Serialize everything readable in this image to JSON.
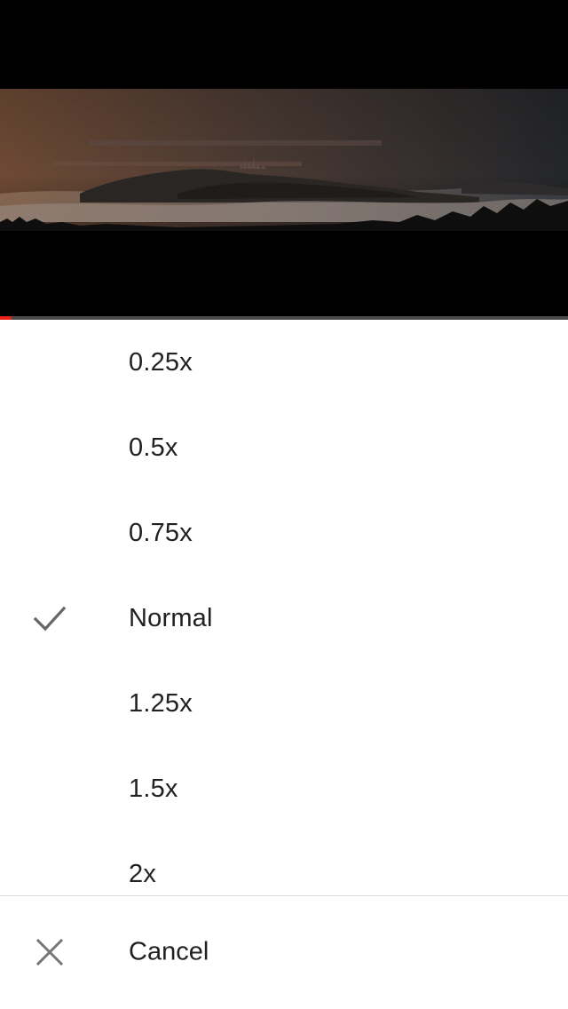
{
  "player": {
    "thumbnail": "sunrise-fog-hills-landscape",
    "progress_fraction": 0.02,
    "progress_color": "#e62117"
  },
  "speed_menu": {
    "options": [
      {
        "label": "0.25x",
        "selected": false
      },
      {
        "label": "0.5x",
        "selected": false
      },
      {
        "label": "0.75x",
        "selected": false
      },
      {
        "label": "Normal",
        "selected": true
      },
      {
        "label": "1.25x",
        "selected": false
      },
      {
        "label": "1.5x",
        "selected": false
      },
      {
        "label": "2x",
        "selected": false
      }
    ],
    "check_icon": "check-icon",
    "cancel_label": "Cancel",
    "cancel_icon": "close-icon"
  }
}
